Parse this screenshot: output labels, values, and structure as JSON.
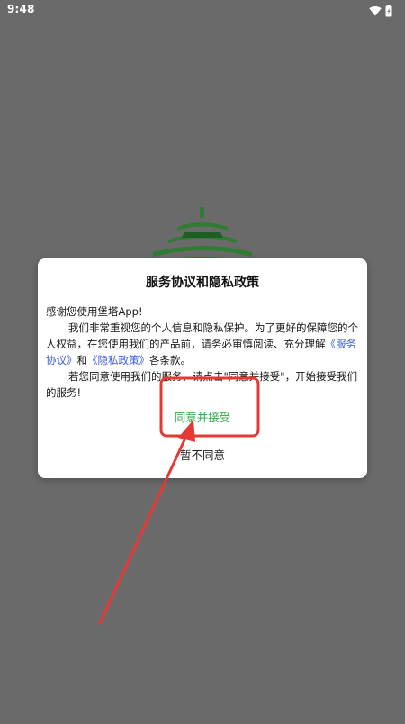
{
  "status_bar": {
    "time": "9:48",
    "icons": [
      "wifi-icon",
      "battery-icon"
    ]
  },
  "app_logo": {
    "icon": "pagoda-logo",
    "color": "#2e7d32"
  },
  "dialog": {
    "title": "服务协议和隐私政策",
    "greeting": "感谢您使用堡塔App!",
    "paragraph1": "我们非常重视您的个人信息和隐私保护。为了更好的保障您的个人权益，在您使用我们的产品前，请务必审慎阅读、充分理解",
    "service_agreement_link": "《服务协议》",
    "and_text": "和",
    "privacy_policy_link": "《隐私政策》",
    "terms_suffix": "各条款。",
    "paragraph2": "若您同意使用我们的服务，请点击\"同意并接受\"，开始接受我们的服务!",
    "agree_label": "同意并接受",
    "decline_label": "暂不同意"
  },
  "colors": {
    "overlay_background": "#6a6a6a",
    "agree_green": "#2ea84a",
    "link_blue": "#3b5bdb",
    "annotation_red": "#e53935"
  }
}
